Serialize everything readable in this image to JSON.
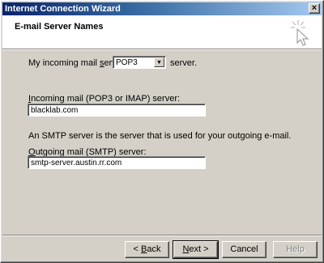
{
  "window": {
    "title": "Internet Connection Wizard",
    "close_glyph": "×"
  },
  "header": {
    "heading": "E-mail Server Names",
    "icon": "wizard-wand-icon"
  },
  "incoming_type": {
    "pre": "My incoming mail ",
    "accel": "s",
    "pre_rest": "erver is a",
    "selected": "POP3",
    "post": "server."
  },
  "incoming": {
    "label_accel": "I",
    "label_rest": "ncoming mail (POP3 or IMAP) server:",
    "value": "blacklab.com"
  },
  "smtp_note": "An SMTP server is the server that is used for your outgoing e-mail.",
  "outgoing": {
    "label_accel": "O",
    "label_rest": "utgoing mail (SMTP) server:",
    "value": "smtp-server.austin.rr.com"
  },
  "buttons": {
    "back_pre": "< ",
    "back_accel": "B",
    "back_rest": "ack",
    "next_accel": "N",
    "next_rest": "ext >",
    "cancel": "Cancel",
    "help": "Help"
  }
}
